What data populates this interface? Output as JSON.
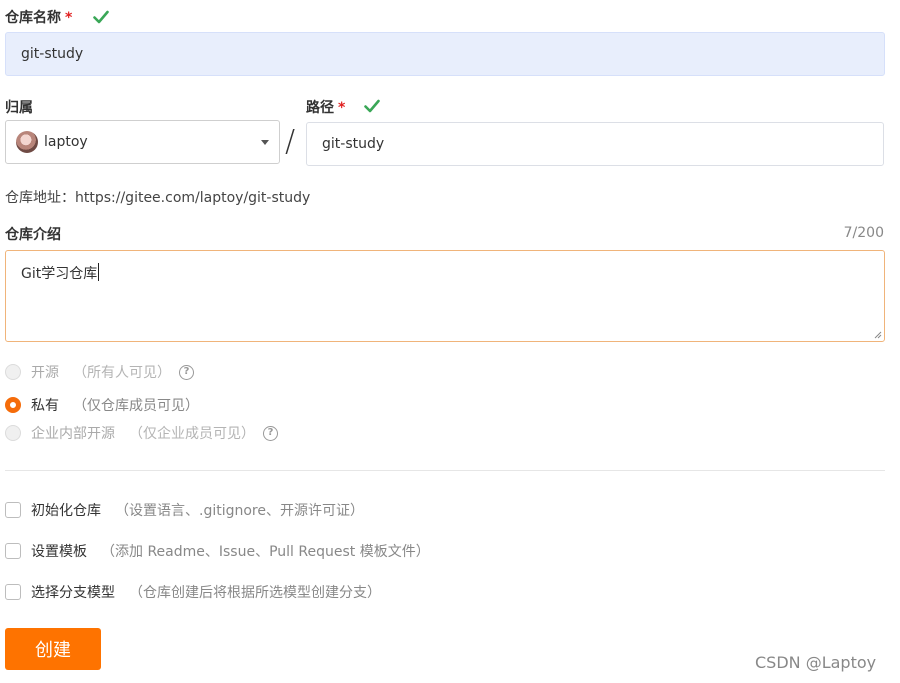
{
  "repo_name": {
    "label": "仓库名称",
    "required_mark": "*",
    "value": "git-study"
  },
  "owner": {
    "label": "归属",
    "selected": "laptoy"
  },
  "separator": "/",
  "path": {
    "label": "路径",
    "required_mark": "*",
    "value": "git-study"
  },
  "repo_url": {
    "label": "仓库地址：",
    "value": "https://gitee.com/laptoy/git-study"
  },
  "description": {
    "label": "仓库介绍",
    "counter": "7/200",
    "value": "Git学习仓库"
  },
  "visibility": {
    "options": [
      {
        "label": "开源",
        "hint": "（所有人可见）",
        "state": "disabled",
        "help": "?"
      },
      {
        "label": "私有",
        "hint": "（仅仓库成员可见）",
        "state": "selected"
      },
      {
        "label": "企业内部开源",
        "hint": "（仅企业成员可见）",
        "state": "disabled",
        "help": "?"
      }
    ]
  },
  "options": [
    {
      "label": "初始化仓库",
      "hint": "（设置语言、.gitignore、开源许可证）",
      "checked": false
    },
    {
      "label": "设置模板",
      "hint": "（添加 Readme、Issue、Pull Request 模板文件）",
      "checked": false
    },
    {
      "label": "选择分支模型",
      "hint": "（仓库创建后将根据所选模型创建分支）",
      "checked": false
    }
  ],
  "submit_label": "创建",
  "watermark": "CSDN @Laptoy",
  "colors": {
    "accent": "#fe7300",
    "success": "#3aa757",
    "required": "#e02020"
  },
  "icons": {
    "valid": "check-icon",
    "owner_avatar": "avatar",
    "dropdown": "chevron-down-icon",
    "help": "question-circle-icon"
  }
}
